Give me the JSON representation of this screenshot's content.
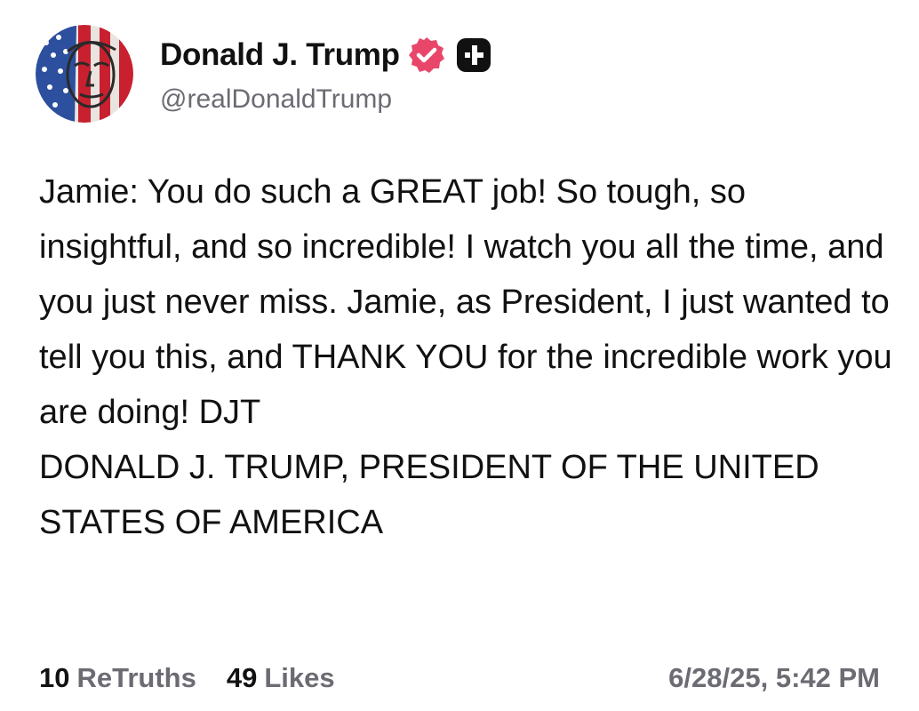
{
  "author": {
    "display_name": "Donald J. Trump",
    "handle": "@realDonaldTrump",
    "avatar_icon": "flag-portrait-avatar",
    "verified_icon": "verified-badge-icon",
    "verified_color": "#e8476a",
    "plus_icon": "truth-plus-icon"
  },
  "post": {
    "paragraphs": [
      "Jamie: You do such a GREAT job! So tough, so insightful, and so incredible! I watch you all the time, and you just never miss. Jamie, as President, I just wanted to tell you this, and THANK YOU for the incredible work you are doing! DJT",
      "DONALD J. TRUMP, PRESIDENT OF THE UNITED STATES OF AMERICA"
    ]
  },
  "stats": {
    "retruths_count": "10",
    "retruths_label": "ReTruths",
    "likes_count": "49",
    "likes_label": "Likes"
  },
  "timestamp": "6/28/25, 5:42 PM",
  "colors": {
    "text": "#111111",
    "muted": "#6b6b73",
    "background": "#ffffff"
  }
}
